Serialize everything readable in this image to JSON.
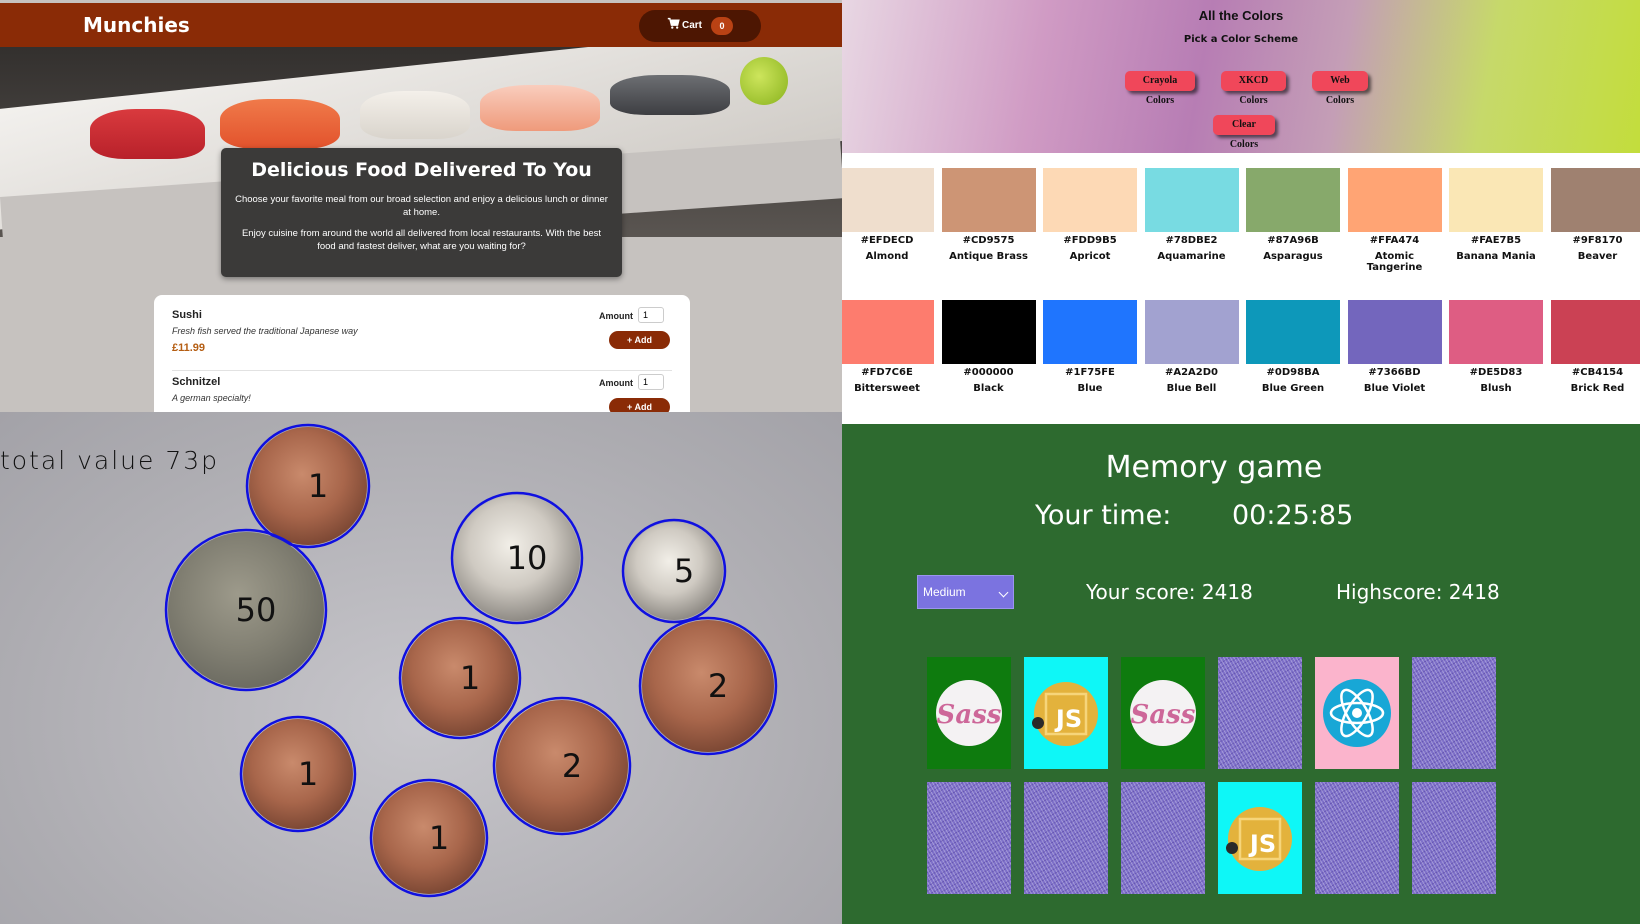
{
  "munchies": {
    "brand": "Munchies",
    "cart": {
      "label": "Cart",
      "count": "0"
    },
    "hero": {
      "title": "Delicious Food Delivered To You",
      "p1": "Choose your favorite meal from our broad selection and enjoy a delicious lunch or dinner at home.",
      "p2": "Enjoy cuisine from around the world all delivered from local restaurants. With the best food and fastest deliver, what are you waiting for?"
    },
    "items": [
      {
        "name": "Sushi",
        "desc": "Fresh fish served the traditional Japanese way",
        "price": "£11.99",
        "amount_label": "Amount",
        "amount": "1",
        "add_label": "+ Add"
      },
      {
        "name": "Schnitzel",
        "desc": "A german specialty!",
        "price": "",
        "amount_label": "Amount",
        "amount": "1",
        "add_label": "+ Add"
      }
    ],
    "colors": {
      "header": "#8a2b06",
      "price": "#b55e13"
    }
  },
  "colors_app": {
    "title": "All the Colors",
    "subtitle": "Pick a Color Scheme",
    "buttons": {
      "crayola": "Crayola Colors",
      "xkcd": "XKCD Colors",
      "web": "Web Colors",
      "clear": "Clear Colors"
    },
    "swatches": [
      {
        "hex": "#EFDECD",
        "name": "Almond"
      },
      {
        "hex": "#CD9575",
        "name": "Antique Brass"
      },
      {
        "hex": "#FDD9B5",
        "name": "Apricot"
      },
      {
        "hex": "#78DBE2",
        "name": "Aquamarine"
      },
      {
        "hex": "#87A96B",
        "name": "Asparagus"
      },
      {
        "hex": "#FFA474",
        "name": "Atomic Tangerine"
      },
      {
        "hex": "#FAE7B5",
        "name": "Banana Mania"
      },
      {
        "hex": "#9F8170",
        "name": "Beaver"
      },
      {
        "hex": "#FD7C6E",
        "name": "Bittersweet"
      },
      {
        "hex": "#000000",
        "name": "Black"
      },
      {
        "hex": "#1F75FE",
        "name": "Blue"
      },
      {
        "hex": "#A2A2D0",
        "name": "Blue Bell"
      },
      {
        "hex": "#0D98BA",
        "name": "Blue Green"
      },
      {
        "hex": "#7366BD",
        "name": "Blue Violet"
      },
      {
        "hex": "#DE5D83",
        "name": "Blush"
      },
      {
        "hex": "#CB4154",
        "name": "Brick Red"
      }
    ]
  },
  "coins": {
    "total_text": "total value 73p",
    "coins": [
      {
        "value": "1",
        "kind": "copper"
      },
      {
        "value": "10",
        "kind": "silver"
      },
      {
        "value": "5",
        "kind": "silver"
      },
      {
        "value": "50",
        "kind": "silver-dark"
      },
      {
        "value": "1",
        "kind": "copper"
      },
      {
        "value": "2",
        "kind": "copper"
      },
      {
        "value": "1",
        "kind": "copper"
      },
      {
        "value": "2",
        "kind": "copper"
      },
      {
        "value": "1",
        "kind": "copper"
      }
    ],
    "outline_color": "#1010e0"
  },
  "memory": {
    "title": "Memory game",
    "time_label": "Your time:",
    "time": "00:25:85",
    "difficulty": "Medium",
    "score_text": "Your score: 2418",
    "highscore_text": "Highscore: 2418",
    "cards": [
      {
        "face": "sass"
      },
      {
        "face": "js"
      },
      {
        "face": "sass"
      },
      {
        "face": "back"
      },
      {
        "face": "react"
      },
      {
        "face": "back"
      },
      {
        "face": "back"
      },
      {
        "face": "back"
      },
      {
        "face": "back"
      },
      {
        "face": "js"
      },
      {
        "face": "back"
      },
      {
        "face": "back"
      }
    ],
    "card_labels": {
      "sass": "Sass",
      "js": "JS"
    }
  }
}
